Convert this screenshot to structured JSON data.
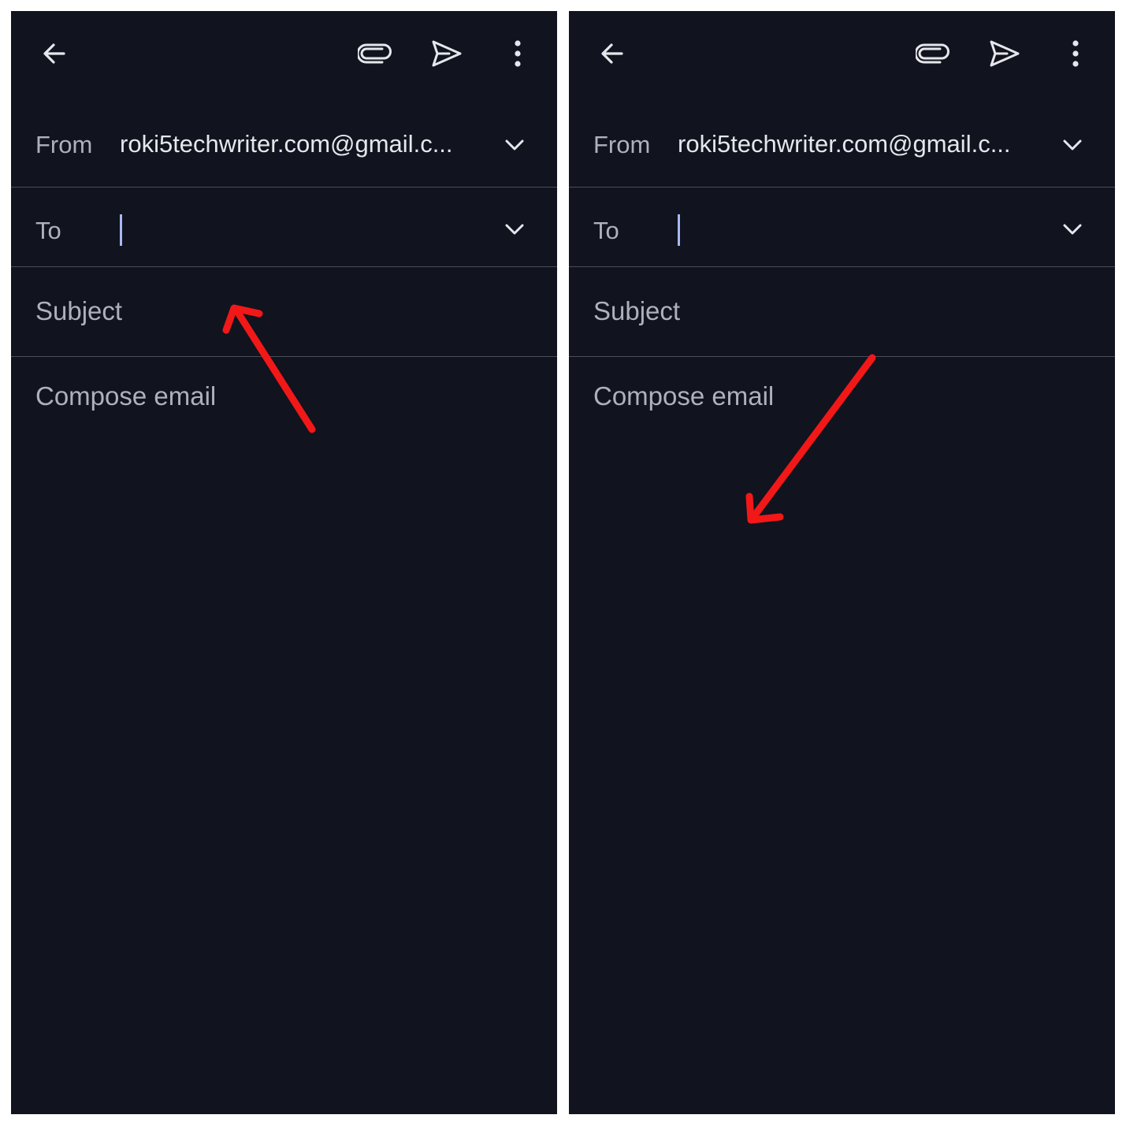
{
  "panels": [
    {
      "from_label": "From",
      "from_value": "roki5techwriter.com@gmail.c...",
      "to_label": "To",
      "subject_placeholder": "Subject",
      "compose_placeholder": "Compose email"
    },
    {
      "from_label": "From",
      "from_value": "roki5techwriter.com@gmail.c...",
      "to_label": "To",
      "subject_placeholder": "Subject",
      "compose_placeholder": "Compose email"
    }
  ],
  "icons": {
    "back": "arrow-back-icon",
    "attach": "paperclip-icon",
    "send": "send-icon",
    "more": "more-vert-icon",
    "expand": "chevron-down-icon"
  },
  "colors": {
    "background": "#11131e",
    "text_primary": "#e6e7ec",
    "text_secondary": "#aeb1bb",
    "divider": "#4a4d58",
    "cursor": "#a9b8f4",
    "annotation_arrow": "#f21818"
  }
}
